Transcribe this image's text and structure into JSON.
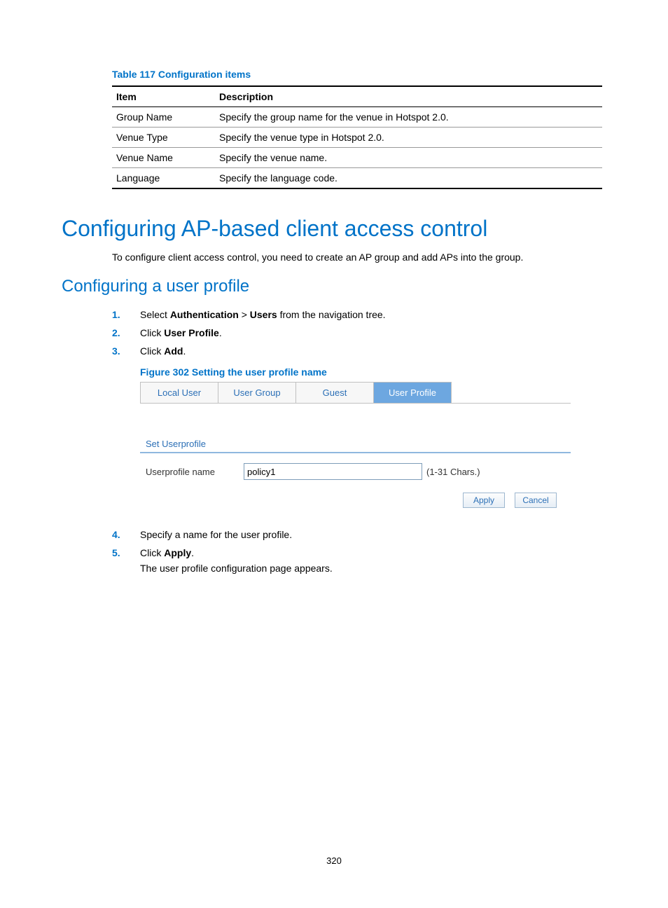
{
  "table": {
    "caption": "Table 117 Configuration items",
    "headers": [
      "Item",
      "Description"
    ],
    "rows": [
      [
        "Group Name",
        "Specify the group name for the venue in Hotspot 2.0."
      ],
      [
        "Venue Type",
        "Specify the venue type in Hotspot 2.0."
      ],
      [
        "Venue Name",
        "Specify the venue name."
      ],
      [
        "Language",
        "Specify the language code."
      ]
    ]
  },
  "h1": "Configuring AP-based client access control",
  "intro": "To configure client access control, you need to create an AP group and add APs into the group.",
  "h2": "Configuring a user profile",
  "steps": {
    "s1_a": "Select ",
    "s1_b": "Authentication",
    "s1_c": " > ",
    "s1_d": "Users",
    "s1_e": " from the navigation tree.",
    "s2_a": "Click ",
    "s2_b": "User Profile",
    "s2_c": ".",
    "s3_a": "Click ",
    "s3_b": "Add",
    "s3_c": ".",
    "s4": "Specify a name for the user profile.",
    "s5_a": "Click ",
    "s5_b": "Apply",
    "s5_c": ".",
    "s5_followup": "The user profile configuration page appears."
  },
  "figure_caption": "Figure 302 Setting the user profile name",
  "screenshot": {
    "tabs": [
      "Local User",
      "User Group",
      "Guest",
      "User Profile"
    ],
    "active_tab_index": 3,
    "section_label": "Set Userprofile",
    "field_label": "Userprofile name",
    "field_value": "policy1",
    "hint": "(1-31 Chars.)",
    "apply": "Apply",
    "cancel": "Cancel"
  },
  "page_number": "320"
}
